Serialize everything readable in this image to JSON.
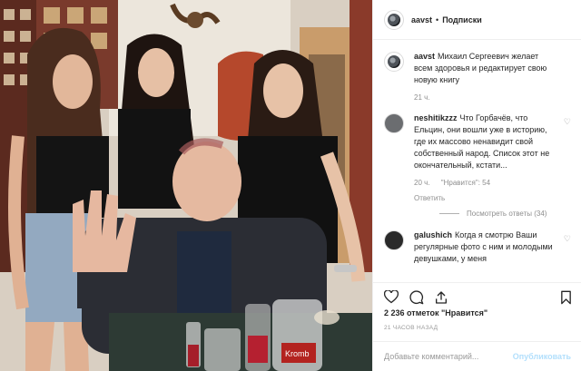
{
  "photo": {
    "alt": "group photo",
    "cake_text": "Kromb"
  },
  "header": {
    "username": "aavst",
    "dot": "•",
    "follow_label": "Подписки",
    "avatar_icon": "profile-avatar-icon"
  },
  "caption": {
    "username": "aavst",
    "text": "Михаил Сергеевич желает всем здоровья и редактирует свою новую книгу",
    "time": "21 ч."
  },
  "comments": [
    {
      "username": "neshitikzzz",
      "text": "Что Горбачёв, что Ельцин, они вошли уже в историю, где их массово ненавидит свой собственный народ. Список этот не окончательный, кстати...",
      "time": "20 ч.",
      "likes": "\"Нравится\": 54",
      "reply_label": "Ответить",
      "replies_label": "Посмотреть ответы (34)",
      "heart_icon": "heart-outline-icon"
    },
    {
      "username": "galushich",
      "text": "Когда я смотрю Ваши регулярные фото с ним и молодыми девушками, у меня",
      "heart_icon": "heart-outline-icon"
    }
  ],
  "actions": {
    "like_icon": "heart-icon",
    "comment_icon": "comment-icon",
    "share_icon": "share-icon",
    "save_icon": "bookmark-icon"
  },
  "likes_count": "2 236 отметок \"Нравится\"",
  "timestamp": "21 ЧАСОВ НАЗАД",
  "add_comment": {
    "placeholder": "Добавьте комментарий...",
    "publish_label": "Опубликовать"
  }
}
